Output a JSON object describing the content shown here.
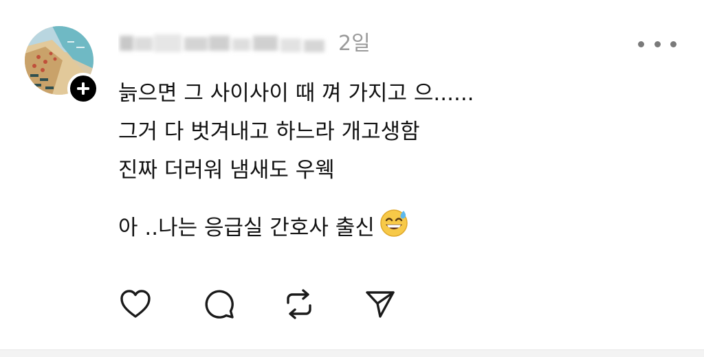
{
  "post": {
    "timestamp": "2일",
    "lines": [
      "늙으면 그 사이사이 때 껴 가지고 으......",
      "그거 다 벗겨내고 하느라 개고생함",
      "진짜 더러워 냄새도 우웩"
    ],
    "last_line": "아 ..나는 응급실 간호사 출신",
    "emoji": "grinning-face-with-sweat"
  },
  "icons": {
    "like": "heart-icon",
    "reply": "comment-icon",
    "repost": "repost-icon",
    "share": "send-icon",
    "more": "more-dots-icon",
    "follow": "plus-icon"
  },
  "colors": {
    "text": "#111111",
    "meta": "#9a9a9a",
    "icon": "#1a1a1a",
    "badge": "#000000"
  }
}
